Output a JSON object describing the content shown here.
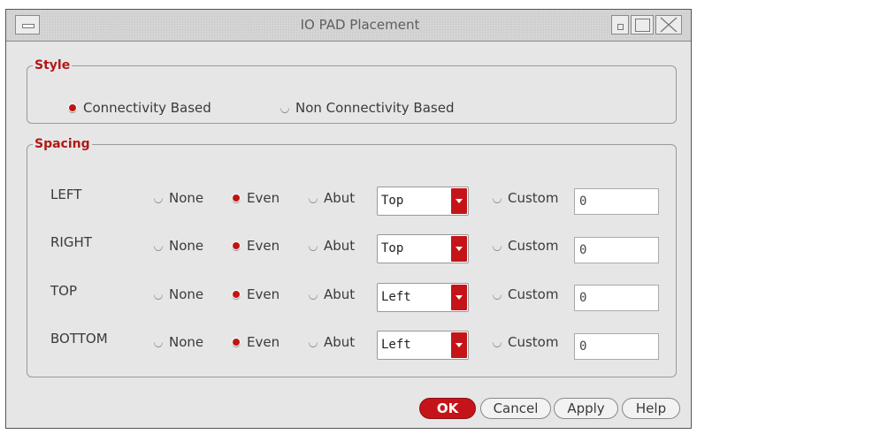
{
  "window": {
    "title": "IO PAD Placement"
  },
  "style": {
    "legend": "Style",
    "options": [
      {
        "label": "Connectivity Based",
        "selected": true
      },
      {
        "label": "Non Connectivity Based",
        "selected": false
      }
    ]
  },
  "spacing": {
    "legend": "Spacing",
    "option_none": "None",
    "option_even": "Even",
    "option_abut": "Abut",
    "option_custom": "Custom",
    "rows": [
      {
        "label": "LEFT",
        "selected": "Even",
        "combo": "Top",
        "custom_value": "0"
      },
      {
        "label": "RIGHT",
        "selected": "Even",
        "combo": "Top",
        "custom_value": "0"
      },
      {
        "label": "TOP",
        "selected": "Even",
        "combo": "Left",
        "custom_value": "0"
      },
      {
        "label": "BOTTOM",
        "selected": "Even",
        "combo": "Left",
        "custom_value": "0"
      }
    ]
  },
  "buttons": {
    "ok": "OK",
    "cancel": "Cancel",
    "apply": "Apply",
    "help": "Help"
  },
  "colors": {
    "accent": "#c4141a",
    "legend": "#b01818",
    "background": "#e6e6e6"
  }
}
